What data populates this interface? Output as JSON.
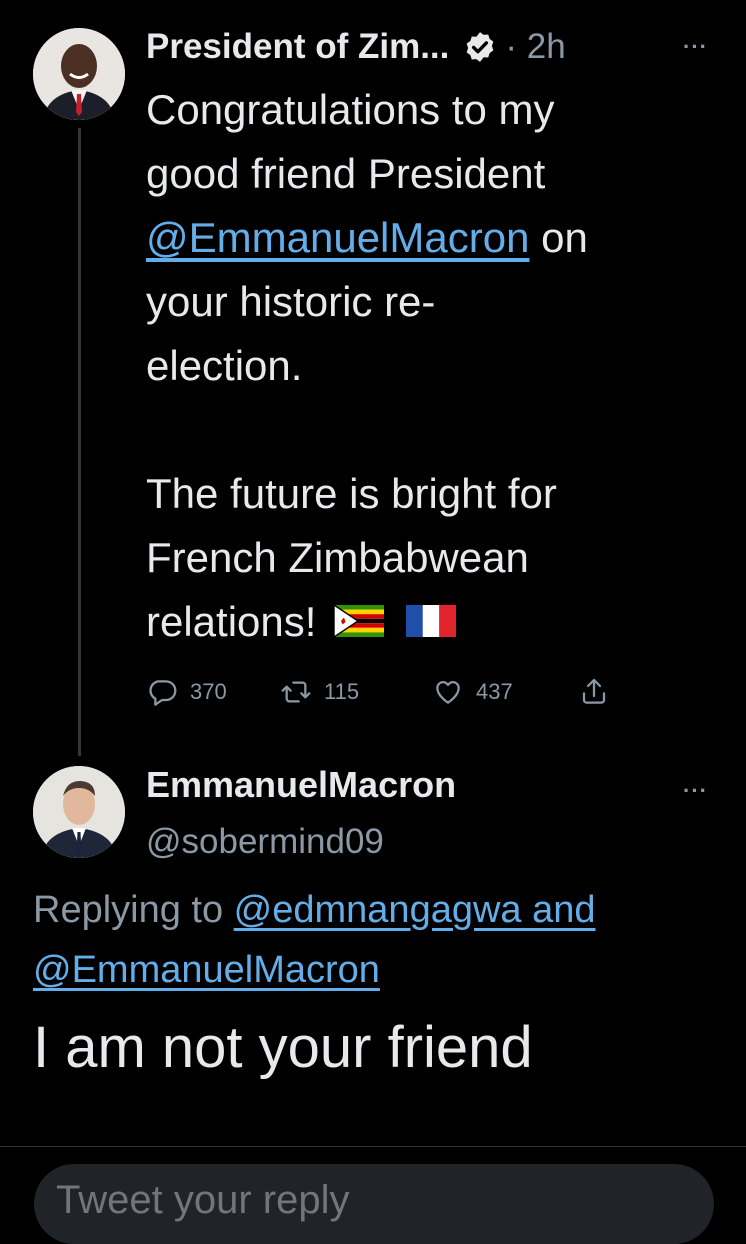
{
  "tweet1": {
    "author_name": "President of Zim...",
    "time": "· 2h",
    "more_label": "···",
    "text_lines": {
      "l1": "Congratulations to my",
      "l2": "good friend President",
      "mention": "@EmmanuelMacron",
      "l3_rest": " on",
      "l4": "your historic re-",
      "l5": "election.",
      "l6": "The future is bright for",
      "l7": "French Zimbabwean",
      "l8": "relations!"
    },
    "stats": {
      "replies": "370",
      "retweets": "115",
      "likes": "437"
    }
  },
  "tweet2": {
    "author_name": "EmmanuelMacron",
    "handle": "@sobermind09",
    "more_label": "···",
    "replying_prefix": "Replying to ",
    "replying_users": "@edmnangagwa and",
    "replying_users_2": "@EmmanuelMacron",
    "text": "I am not your friend"
  },
  "compose": {
    "placeholder": "Tweet your reply"
  },
  "colors": {
    "link": "#63aee8",
    "muted": "#8b98a5",
    "background": "#000000"
  }
}
